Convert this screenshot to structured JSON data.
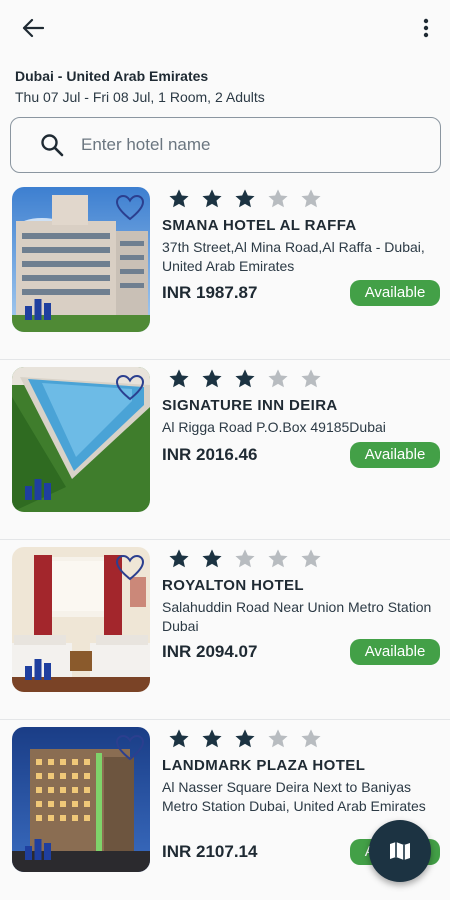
{
  "header": {
    "back_icon": "arrow-left-icon",
    "more_icon": "more-vertical-icon"
  },
  "summary": {
    "location": "Dubai - United Arab Emirates",
    "dates": "Thu 07 Jul - Fri 08 Jul, 1 Room, 2 Adults"
  },
  "search": {
    "placeholder": "Enter hotel name",
    "value": "",
    "icon": "search-icon"
  },
  "colors": {
    "star_filled": "#1c3342",
    "star_empty": "#b8bcc0",
    "available": "#43a047",
    "fab": "#1c3342",
    "heart": "#2b3f8f",
    "chart_badge": "#1f3f9f"
  },
  "hotels": [
    {
      "name": "SMANA HOTEL AL RAFFA",
      "address": "37th Street,Al Mina Road,Al Raffa - Dubai, United Arab Emirates",
      "price": "INR 1987.87",
      "status": "Available",
      "stars": 3,
      "max_stars": 5
    },
    {
      "name": "SIGNATURE INN DEIRA",
      "address": "Al Rigga Road P.O.Box 49185Dubai",
      "price": "INR 2016.46",
      "status": "Available",
      "stars": 3,
      "max_stars": 5
    },
    {
      "name": "ROYALTON HOTEL",
      "address": "Salahuddin Road Near Union Metro Station Dubai",
      "price": "INR 2094.07",
      "status": "Available",
      "stars": 2,
      "max_stars": 5
    },
    {
      "name": "LANDMARK PLAZA HOTEL",
      "address": "Al Nasser Square Deira Next to Baniyas Metro Station Dubai, United Arab Emirates",
      "price": "INR 2107.14",
      "status": "Available",
      "stars": 3,
      "max_stars": 5
    }
  ],
  "fab": {
    "icon": "map-icon"
  }
}
